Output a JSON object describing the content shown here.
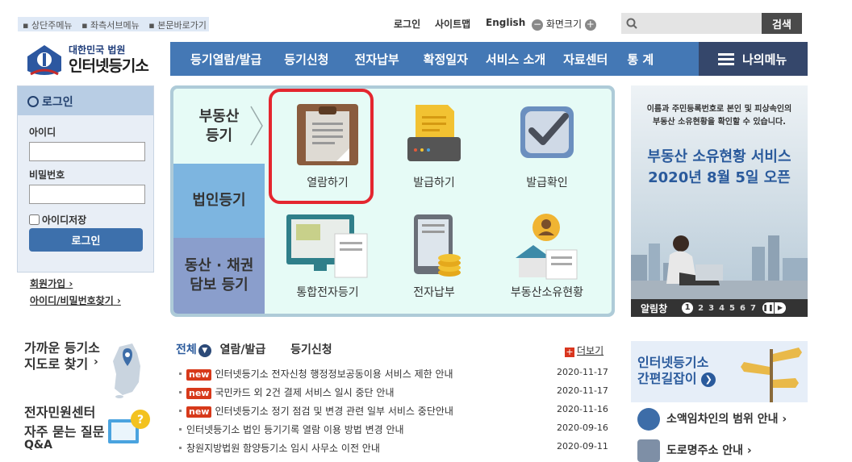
{
  "skip_links": [
    "상단주메뉴",
    "좌측서브메뉴",
    "본문바로가기"
  ],
  "util": {
    "login": "로그인",
    "sitemap": "사이트맵",
    "english": "English",
    "zoom_label": "화면크기",
    "zoom_minus": "−",
    "zoom_plus": "+",
    "search_button": "검색",
    "search_placeholder": ""
  },
  "logo": {
    "sub": "대한민국 법원",
    "main": "인터넷등기소"
  },
  "gnb": [
    "등기열람/발급",
    "등기신청",
    "전자납부",
    "확정일자",
    "서비스 소개",
    "자료센터",
    "통 계"
  ],
  "my_menu": "나의메뉴",
  "login_box": {
    "title": "로그인",
    "id_label": "아이디",
    "pw_label": "비밀번호",
    "save_id": "아이디저장",
    "button": "로그인",
    "join": "회원가입",
    "find": "아이디/비밀번호찾기"
  },
  "panel": {
    "tabs": [
      {
        "label": "부동산\n등기"
      },
      {
        "label": "법인등기"
      },
      {
        "label": "동산 · 채권\n담보 등기"
      }
    ],
    "services": [
      "열람하기",
      "발급하기",
      "발급확인",
      "통합전자등기",
      "전자납부",
      "부동산소유현황"
    ]
  },
  "banner": {
    "line1": "이름과 주민등록번호로 본인 및 피상속인의",
    "line2": "부동산 소유현황을 확인할 수 있습니다.",
    "title": "부동산 소유현황 서비스",
    "date": "2020년 8월 5일 오픈",
    "footer_label": "알림창",
    "pages": [
      "1",
      "2",
      "3",
      "4",
      "5",
      "6",
      "7"
    ],
    "active_page": "1"
  },
  "left_bottom": {
    "nearest": "가까운 등기소\n지도로 찾기",
    "civil": "전자민원센터",
    "faq": "자주 묻는 질문",
    "qa": "Q&A"
  },
  "notice": {
    "tabs": [
      "전체",
      "열람/발급",
      "등기신청"
    ],
    "more": "더보기",
    "new_label": "new",
    "rows": [
      {
        "isNew": true,
        "title": "인터넷등기소 전자신청 행정정보공동이용 서비스 제한 안내",
        "date": "2020-11-17"
      },
      {
        "isNew": true,
        "title": "국민카드 외 2건 결제 서비스 일시 중단 안내",
        "date": "2020-11-17"
      },
      {
        "isNew": true,
        "title": "인터넷등기소 정기 점검 및 변경 관련 일부 서비스 중단안내",
        "date": "2020-11-16"
      },
      {
        "isNew": false,
        "title": "인터넷등기소 법인 등기기록 열람 이용 방법 변경 안내",
        "date": "2020-09-16"
      },
      {
        "isNew": false,
        "title": "창원지방법원 함양등기소 임시 사무소 이전 안내",
        "date": "2020-09-11"
      }
    ]
  },
  "right_bottom": {
    "guide": "인터넷등기소\n간편길잡이",
    "guide_arrow": "❯",
    "link1": "소액임차인의 범위 안내",
    "link2": "도로명주소 안내"
  },
  "colors": {
    "gnb": "#4478b5",
    "mymenu": "#35476b",
    "highlight": "#e4262f",
    "new_badge": "#d7391a"
  }
}
